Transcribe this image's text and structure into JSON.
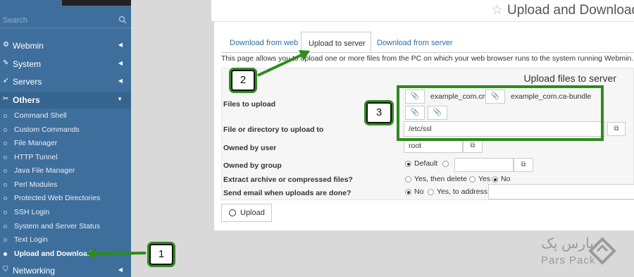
{
  "sidebar": {
    "search_placeholder": "Search",
    "items": [
      {
        "label": "Webmin"
      },
      {
        "label": "System"
      },
      {
        "label": "Servers"
      },
      {
        "label": "Others"
      },
      {
        "label": "Networking"
      }
    ],
    "sub_items": [
      {
        "label": "Command Shell"
      },
      {
        "label": "Custom Commands"
      },
      {
        "label": "File Manager"
      },
      {
        "label": "HTTP Tunnel"
      },
      {
        "label": "Java File Manager"
      },
      {
        "label": "Perl Modules"
      },
      {
        "label": "Protected Web Directories"
      },
      {
        "label": "SSH Login"
      },
      {
        "label": "System and Server Status"
      },
      {
        "label": "Text Login"
      },
      {
        "label": "Upload and Download"
      }
    ]
  },
  "header": {
    "title": "Upload and Download"
  },
  "tabs": [
    {
      "label": "Download from web"
    },
    {
      "label": "Upload to server"
    },
    {
      "label": "Download from server"
    }
  ],
  "intro_text": "This page allows you to upload one or more files from the PC on which your web browser runs to the system running Webmin.",
  "form": {
    "title": "Upload files to server",
    "files_label": "Files to upload",
    "file1": "example_com.crt",
    "file2": "example_com.ca-bundle",
    "dest_label": "File or directory to upload to",
    "dest_value": "/etc/ssl",
    "owner_label": "Owned by user",
    "owner_value": "root",
    "group_label": "Owned by group",
    "group_default": "Default",
    "extract_label": "Extract archive or compressed files?",
    "extract_opt1": "Yes, then delete",
    "extract_opt2": "Yes",
    "extract_opt3": "No",
    "email_label": "Send email when uploads are done?",
    "email_opt1": "No",
    "email_opt2": "Yes, to address"
  },
  "upload_button": "Upload",
  "annotations": {
    "n1": "1",
    "n2": "2",
    "n3": "3"
  },
  "logo": {
    "fa": "پارس پک",
    "en": "Pars Pack"
  },
  "colors": {
    "sidebar": "#3e6f9c",
    "annotation": "#2e8b1e"
  }
}
